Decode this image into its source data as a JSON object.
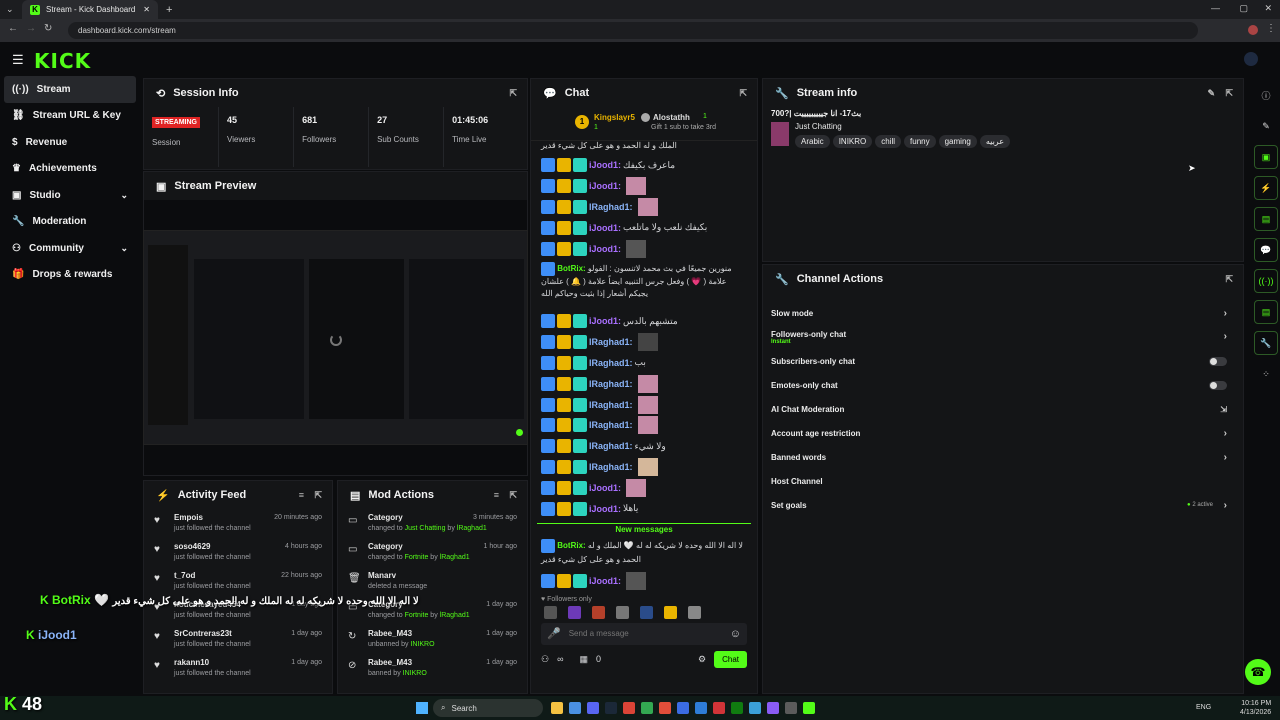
{
  "browser": {
    "tab_title": "Stream - Kick Dashboard",
    "url": "dashboard.kick.com/stream"
  },
  "sidebar": {
    "items": [
      {
        "label": "Stream"
      },
      {
        "label": "Stream URL & Key"
      },
      {
        "label": "Revenue"
      },
      {
        "label": "Achievements"
      },
      {
        "label": "Studio"
      },
      {
        "label": "Moderation"
      },
      {
        "label": "Community"
      },
      {
        "label": "Drops & rewards"
      }
    ]
  },
  "session": {
    "title": "Session Info",
    "status": "STREAMING",
    "status_label": "Session",
    "viewers": "45",
    "viewers_label": "Viewers",
    "followers": "681",
    "followers_label": "Followers",
    "subs": "27",
    "subs_label": "Sub Counts",
    "time": "01:45:06",
    "time_label": "Time Live"
  },
  "preview": {
    "title": "Stream Preview"
  },
  "activity": {
    "title": "Activity Feed",
    "items": [
      {
        "name": "Empois",
        "sub": "just followed the channel",
        "time": "20 minutes ago"
      },
      {
        "name": "soso4629",
        "sub": "just followed the channel",
        "time": "4 hours ago"
      },
      {
        "name": "t_7od",
        "sub": "just followed the channel",
        "time": "22 hours ago"
      },
      {
        "name": "houcinesayed454",
        "sub": "just followed the channel",
        "time": "1 day ago"
      },
      {
        "name": "SrContreras23t",
        "sub": "just followed the channel",
        "time": "1 day ago"
      },
      {
        "name": "rakann10",
        "sub": "just followed the channel",
        "time": "1 day ago"
      }
    ]
  },
  "mod": {
    "title": "Mod Actions",
    "items": [
      {
        "name": "Category",
        "pre": "changed to",
        "val": "Just Chatting",
        "by": "by",
        "who": "lRaghad1",
        "time": "3 minutes ago"
      },
      {
        "name": "Category",
        "pre": "changed to",
        "val": "Fortnite",
        "by": "by",
        "who": "lRaghad1",
        "time": "1 hour ago"
      },
      {
        "name": "Manarv",
        "pre": "deleted a message",
        "val": "",
        "by": "",
        "who": "",
        "time": ""
      },
      {
        "name": "Category",
        "pre": "changed to",
        "val": "Fortnite",
        "by": "by",
        "who": "lRaghad1",
        "time": "1 day ago"
      },
      {
        "name": "Rabee_M43",
        "pre": "unbanned by",
        "val": "INIKRO",
        "by": "",
        "who": "",
        "time": "1 day ago"
      },
      {
        "name": "Rabee_M43",
        "pre": "banned by",
        "val": "INIKRO",
        "by": "",
        "who": "",
        "time": "1 day ago"
      }
    ]
  },
  "chat": {
    "title": "Chat",
    "top_gifter": "Kingslayr5",
    "top_gifter_count": "1",
    "gifter2": "Alostathh",
    "gifter2_count": "1",
    "gift_note": "Gift 1 sub to take 3rd",
    "top_line": "الملك و له الحمد و هو على كل شيء قدير",
    "messages": [
      {
        "user": "iJood1:",
        "cls": "u1",
        "text": "ماعرف بكيفك"
      },
      {
        "user": "iJood1:",
        "cls": "u1",
        "text": ""
      },
      {
        "user": "lRaghad1:",
        "cls": "u2",
        "text": ""
      },
      {
        "user": "iJood1:",
        "cls": "u1",
        "text": "بكيفك نلعب ولا ماتلعب"
      },
      {
        "user": "iJood1:",
        "cls": "u1",
        "text": ""
      },
      {
        "user": "BotRix:",
        "cls": "u3",
        "text": "منورين جميعًا في بث محمد لاتنسون : الفولو علامة ( 💗 ) وفعل جرس التنبيه ايضاً علامة ( 🔔 ) علشان يجيكم أشعار إذا بثيت وحياكم الله"
      },
      {
        "user": "iJood1:",
        "cls": "u1",
        "text": "متشبهم بالدس"
      },
      {
        "user": "lRaghad1:",
        "cls": "u2",
        "text": ""
      },
      {
        "user": "lRaghad1:",
        "cls": "u2",
        "text": "بب"
      },
      {
        "user": "lRaghad1:",
        "cls": "u2",
        "text": ""
      },
      {
        "user": "lRaghad1:",
        "cls": "u2",
        "text": ""
      },
      {
        "user": "lRaghad1:",
        "cls": "u2",
        "text": ""
      },
      {
        "user": "lRaghad1:",
        "cls": "u2",
        "text": "ولا شيء"
      },
      {
        "user": "lRaghad1:",
        "cls": "u2",
        "text": ""
      },
      {
        "user": "iJood1:",
        "cls": "u1",
        "text": ""
      },
      {
        "user": "iJood1:",
        "cls": "u1",
        "text": "ياهلا"
      }
    ],
    "new_messages": "New messages",
    "botrix_user": "BotRix:",
    "botrix_text": "لا اله الا الله وحده لا شريكه له له 🤍 الملك و له الحمد و هو على كل شيء قدير",
    "last_user": "iJood1:",
    "followers_only": "Followers only",
    "input_placeholder": "Send a message",
    "infinity": "∞",
    "zero": "0",
    "send_label": "Chat"
  },
  "stream_info": {
    "title": "Stream info",
    "stream_title": "700?| بث17- انا جيييييييييت",
    "category": "Just Chatting",
    "tags": [
      "Arabic",
      "INIKRO",
      "chill",
      "funny",
      "gaming",
      "عربيه"
    ]
  },
  "channel_actions": {
    "title": "Channel Actions",
    "items": [
      {
        "label": "Slow mode",
        "ctl": "chev"
      },
      {
        "label": "Followers-only chat",
        "sub": "Instant",
        "ctl": "chev"
      },
      {
        "label": "Subscribers-only chat",
        "ctl": "tog"
      },
      {
        "label": "Emotes-only chat",
        "ctl": "tog"
      },
      {
        "label": "AI Chat Moderation",
        "ctl": "ext"
      },
      {
        "label": "Account age restriction",
        "ctl": "chev"
      },
      {
        "label": "Banned words",
        "ctl": "chev"
      },
      {
        "label": "Host Channel",
        "ctl": ""
      },
      {
        "label": "Set goals",
        "ctl": "chev",
        "extra": "2 active"
      }
    ]
  },
  "overlay": {
    "botrix": "BotRix",
    "botrix_msg": "لا اله الا الله وحده لا شريكه له له الملك و له الحمد و هو على كل شيء قدير",
    "jood": "iJood1",
    "counter": "48"
  },
  "taskbar": {
    "search": "Search",
    "lang": "ENG",
    "time": "10:16 PM",
    "date": "4/13/2026"
  },
  "colors": {
    "accent": "#53fc18",
    "live": "#e02424"
  }
}
